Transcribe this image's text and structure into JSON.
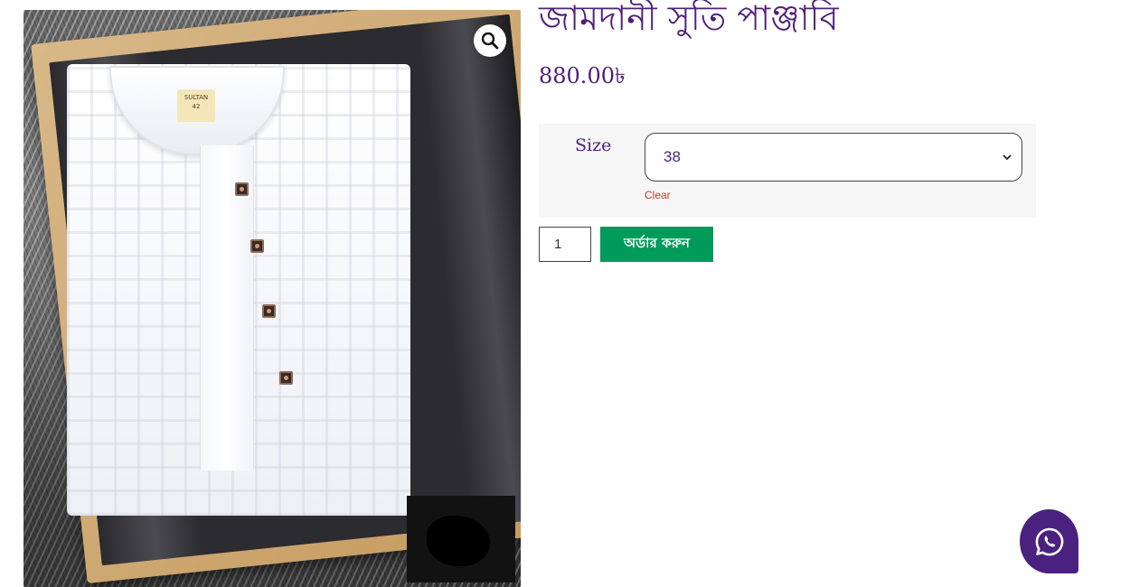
{
  "product": {
    "title": "জামদানী সুতি পাঞ্জাবি",
    "price": "880.00৳",
    "gallery": {
      "label_tag_brand": "SULTAN",
      "label_tag_size": "42"
    }
  },
  "variations": {
    "size_label": "Size",
    "size_selected": "38",
    "clear_label": "Clear"
  },
  "cart": {
    "quantity": "1",
    "order_button_label": "অর্ডার করুন"
  },
  "icons": {
    "zoom": "magnifier-icon",
    "whatsapp": "whatsapp-icon"
  },
  "colors": {
    "title": "#4f1f79",
    "order_button": "#009a5a",
    "whatsapp_button": "#4b2180",
    "clear_link": "#c0392b",
    "variation_panel": "#f6f6f6"
  }
}
